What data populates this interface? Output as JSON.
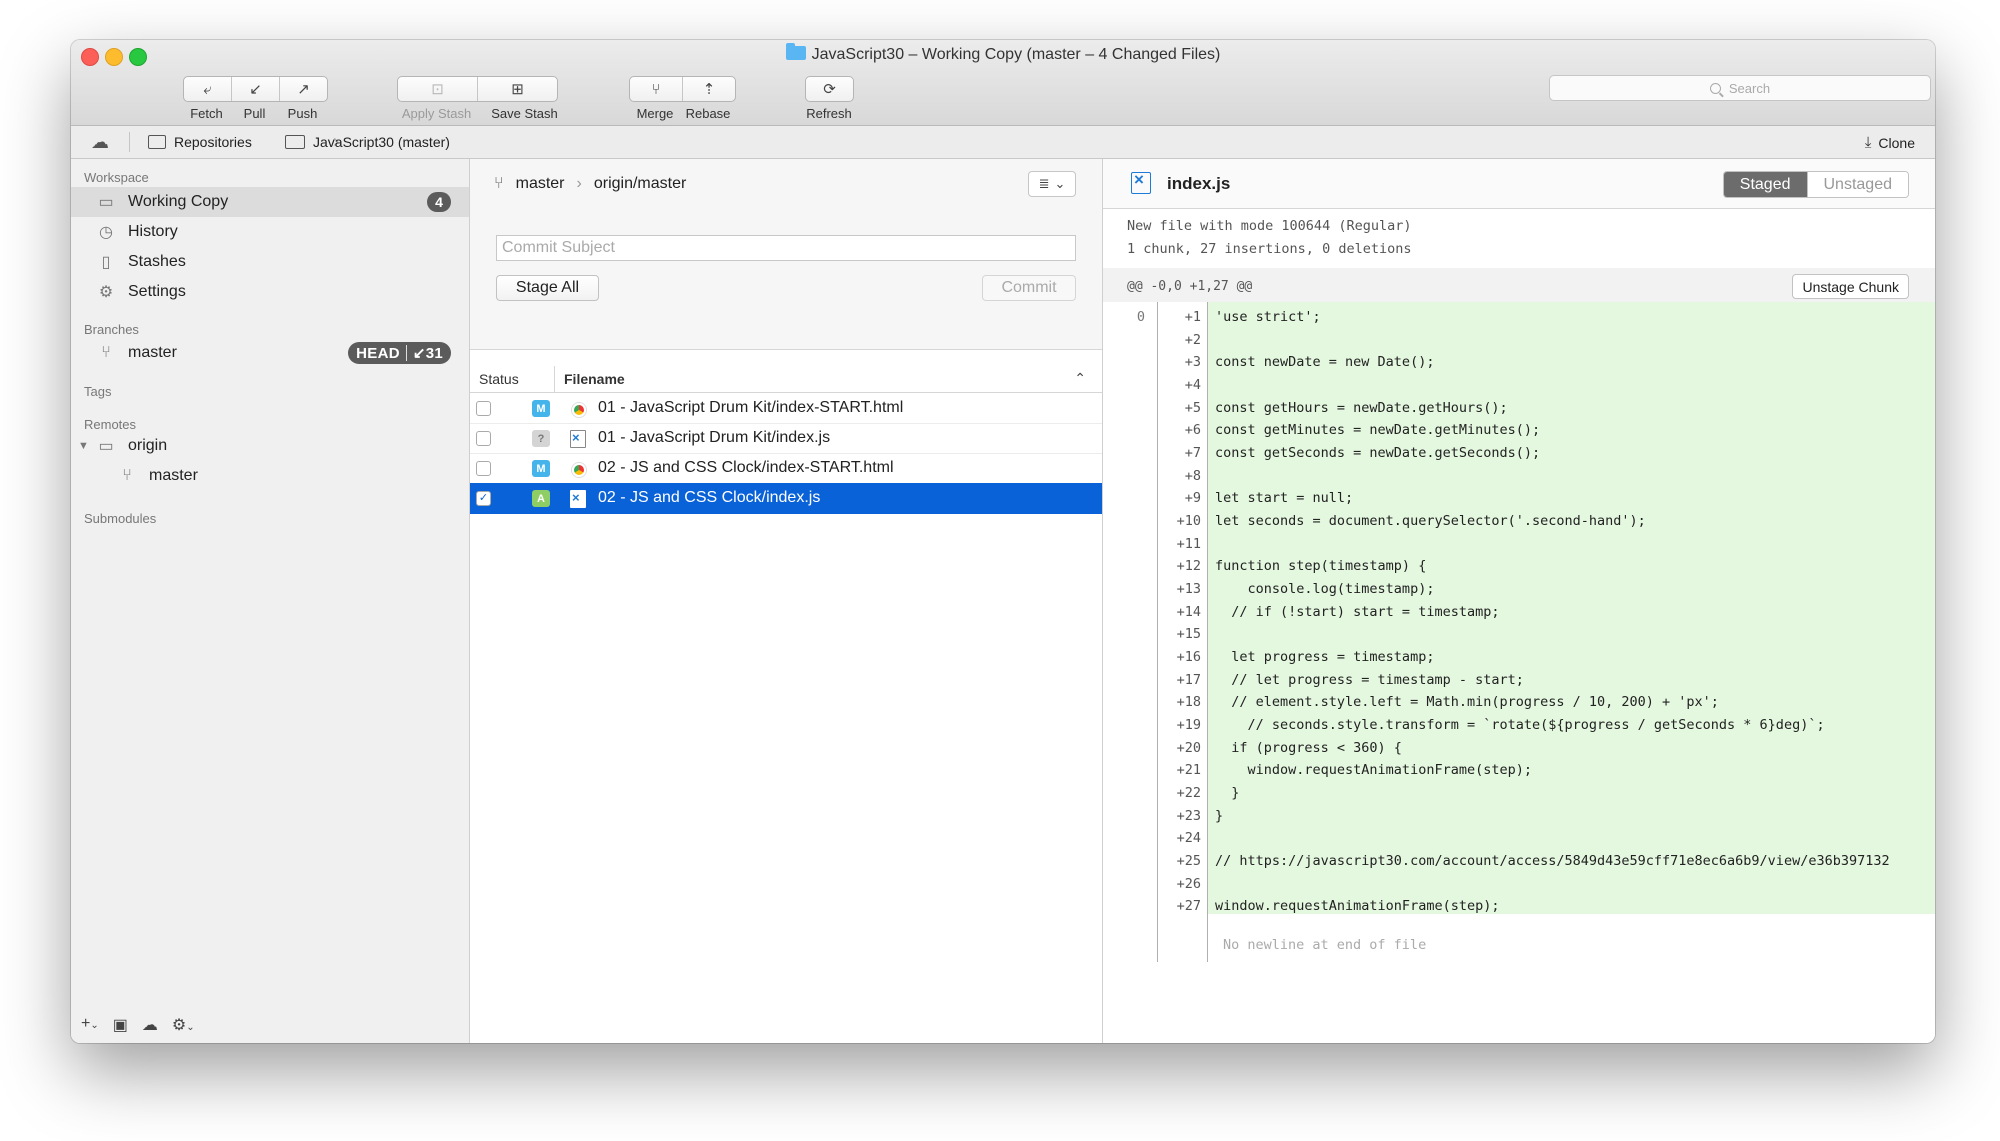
{
  "window": {
    "title": "JavaScript30 – Working Copy (master – 4 Changed Files)"
  },
  "toolbar": {
    "fetch": "Fetch",
    "pull": "Pull",
    "push": "Push",
    "apply_stash": "Apply Stash",
    "save_stash": "Save Stash",
    "merge": "Merge",
    "rebase": "Rebase",
    "refresh": "Refresh",
    "search_placeholder": "Search"
  },
  "pathbar": {
    "repositories": "Repositories",
    "repo": "JavaScript30 (master)",
    "clone": "Clone"
  },
  "sidebar": {
    "workspace_header": "Workspace",
    "working_copy": "Working Copy",
    "working_copy_count": "4",
    "history": "History",
    "stashes": "Stashes",
    "settings": "Settings",
    "branches_header": "Branches",
    "branch_master": "master",
    "head_label": "HEAD",
    "head_count": "↙31",
    "tags_header": "Tags",
    "remotes_header": "Remotes",
    "remote_origin": "origin",
    "remote_master": "master",
    "submodules_header": "Submodules"
  },
  "commit": {
    "branch": "master",
    "upstream": "origin/master",
    "subject_placeholder": "Commit Subject",
    "stage_all": "Stage All",
    "commit_button": "Commit"
  },
  "files": {
    "col_status": "Status",
    "col_filename": "Filename",
    "rows": [
      {
        "status": "M",
        "type": "chrome",
        "name": "01 - JavaScript Drum Kit/index-START.html",
        "checked": false,
        "selected": false
      },
      {
        "status": "?",
        "type": "js",
        "name": "01 - JavaScript Drum Kit/index.js",
        "checked": false,
        "selected": false
      },
      {
        "status": "M",
        "type": "chrome",
        "name": "02 - JS and CSS Clock/index-START.html",
        "checked": false,
        "selected": false
      },
      {
        "status": "A",
        "type": "js",
        "name": "02 - JS and CSS Clock/index.js",
        "checked": true,
        "selected": true
      }
    ]
  },
  "diff": {
    "file": "index.js",
    "staged": "Staged",
    "unstaged": "Unstaged",
    "meta1": "New file with mode 100644 (Regular)",
    "meta2": "1 chunk, 27 insertions, 0 deletions",
    "hunk": "@@ -0,0 +1,27 @@",
    "unstage_chunk": "Unstage Chunk",
    "old_line": "0",
    "lines": [
      {
        "n": "+1",
        "code": "'use strict';"
      },
      {
        "n": "+2",
        "code": ""
      },
      {
        "n": "+3",
        "code": "const newDate = new Date();"
      },
      {
        "n": "+4",
        "code": ""
      },
      {
        "n": "+5",
        "code": "const getHours = newDate.getHours();"
      },
      {
        "n": "+6",
        "code": "const getMinutes = newDate.getMinutes();"
      },
      {
        "n": "+7",
        "code": "const getSeconds = newDate.getSeconds();"
      },
      {
        "n": "+8",
        "code": ""
      },
      {
        "n": "+9",
        "code": "let start = null;"
      },
      {
        "n": "+10",
        "code": "let seconds = document.querySelector('.second-hand');"
      },
      {
        "n": "+11",
        "code": ""
      },
      {
        "n": "+12",
        "code": "function step(timestamp) {"
      },
      {
        "n": "+13",
        "code": "    console.log(timestamp);"
      },
      {
        "n": "+14",
        "code": "  // if (!start) start = timestamp;"
      },
      {
        "n": "+15",
        "code": ""
      },
      {
        "n": "+16",
        "code": "  let progress = timestamp;"
      },
      {
        "n": "+17",
        "code": "  // let progress = timestamp - start;"
      },
      {
        "n": "+18",
        "code": "  // element.style.left = Math.min(progress / 10, 200) + 'px';"
      },
      {
        "n": "+19",
        "code": "    // seconds.style.transform = `rotate(${progress / getSeconds * 6}deg)`;"
      },
      {
        "n": "+20",
        "code": "  if (progress < 360) {"
      },
      {
        "n": "+21",
        "code": "    window.requestAnimationFrame(step);"
      },
      {
        "n": "+22",
        "code": "  }"
      },
      {
        "n": "+23",
        "code": "}"
      },
      {
        "n": "+24",
        "code": ""
      },
      {
        "n": "+25",
        "code": "// https://javascript30.com/account/access/5849d43e59cff71e8ec6a6b9/view/e36b397132"
      },
      {
        "n": "+26",
        "code": ""
      },
      {
        "n": "+27",
        "code": "window.requestAnimationFrame(step);"
      }
    ],
    "no_newline": "No newline at end of file"
  },
  "footer": {
    "add": "+",
    "menu_caret": "⌄"
  },
  "colors": {
    "selection": "#0a62d8",
    "added_bg": "#e4f7df",
    "status_modified": "#44b4eb",
    "status_added": "#8fce64"
  }
}
